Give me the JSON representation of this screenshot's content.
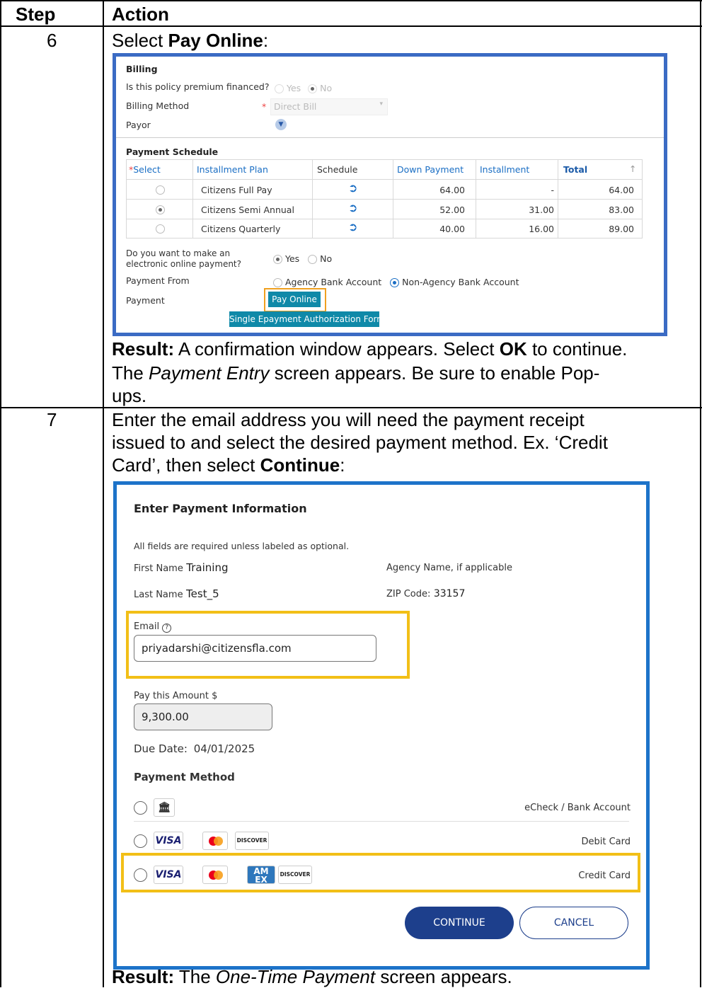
{
  "table": {
    "header_step": "Step",
    "header_action": "Action"
  },
  "step6": {
    "number": "6",
    "instruction_pre": "Select ",
    "instruction_bold": "Pay Online",
    "instruction_post": ":",
    "result_label": "Result:",
    "result_text1": " A confirmation window appears. Select ",
    "result_bold": "OK",
    "result_text2": " to continue.",
    "result_line2_pre": "The ",
    "result_line2_italic": "Payment Entry",
    "result_line2_post": " screen appears. Be sure to enable Pop-",
    "result_line3": "ups."
  },
  "screenshot1": {
    "billing_title": "Billing",
    "premium_financed_label": "Is this policy premium financed?",
    "yes": "Yes",
    "no": "No",
    "billing_method_label": "Billing Method",
    "billing_method_value": "Direct Bill",
    "payor_label": "Payor",
    "schedule_title": "Payment Schedule",
    "columns": [
      "Select",
      "Installment Plan",
      "Schedule",
      "Down Payment",
      "Installment",
      "Total"
    ],
    "rows": [
      {
        "plan": "Citizens Full Pay",
        "down": "64.00",
        "installment": "-",
        "total": "64.00",
        "selected": false
      },
      {
        "plan": "Citizens Semi Annual",
        "down": "52.00",
        "installment": "31.00",
        "total": "83.00",
        "selected": true
      },
      {
        "plan": "Citizens Quarterly",
        "down": "40.00",
        "installment": "16.00",
        "total": "89.00",
        "selected": false
      }
    ],
    "eop_label_1": "Do you want to make an",
    "eop_label_2": "electronic online payment?",
    "eop_yes": "Yes",
    "eop_no": "No",
    "payment_from_label": "Payment From",
    "agency_bank": "Agency Bank Account",
    "non_agency_bank": "Non-Agency Bank Account",
    "payment_label": "Payment",
    "pay_online_button": "Pay Online",
    "single_epay_button": "Single Epayment Authorization Form"
  },
  "step7": {
    "number": "7",
    "line1": "Enter the email address you will need the payment receipt",
    "line2": "issued to and select the desired payment method. Ex. ‘Credit",
    "line3_pre": "Card’, then select ",
    "line3_bold": "Continue",
    "line3_post": ":",
    "result_label": "Result:",
    "result_pre": " The ",
    "result_italic": "One-Time Payment",
    "result_post": " screen appears."
  },
  "screenshot2": {
    "title": "Enter Payment Information",
    "required_note": "All fields are required unless labeled as optional.",
    "first_name_label": "First Name",
    "first_name_value": "Training",
    "agency_name_label": "Agency Name, if applicable",
    "last_name_label": "Last Name",
    "last_name_value": "Test_5",
    "zip_label": "ZIP Code:",
    "zip_value": "33157",
    "email_label": "Email",
    "email_value": "priyadarshi@citizensfla.com",
    "amount_label": "Pay this Amount $",
    "amount_value": "9,300.00",
    "due_date_label": "Due Date:",
    "due_date_value": "04/01/2025",
    "payment_method_title": "Payment Method",
    "echeck_label": "eCheck / Bank Account",
    "debit_label": "Debit Card",
    "credit_label": "Credit Card",
    "visa": "VISA",
    "discover": "DISCOVER",
    "amex": "AM EX",
    "continue_button": "CONTINUE",
    "cancel_button": "CANCEL"
  },
  "colors": {
    "shot1_border": "#3b6bc4",
    "shot2_border": "#1d73c9",
    "highlight_yellow": "#f2bf17",
    "highlight_orange": "#f0a020",
    "teal_button": "#0f89a8",
    "continue_button": "#1d3f8c"
  }
}
